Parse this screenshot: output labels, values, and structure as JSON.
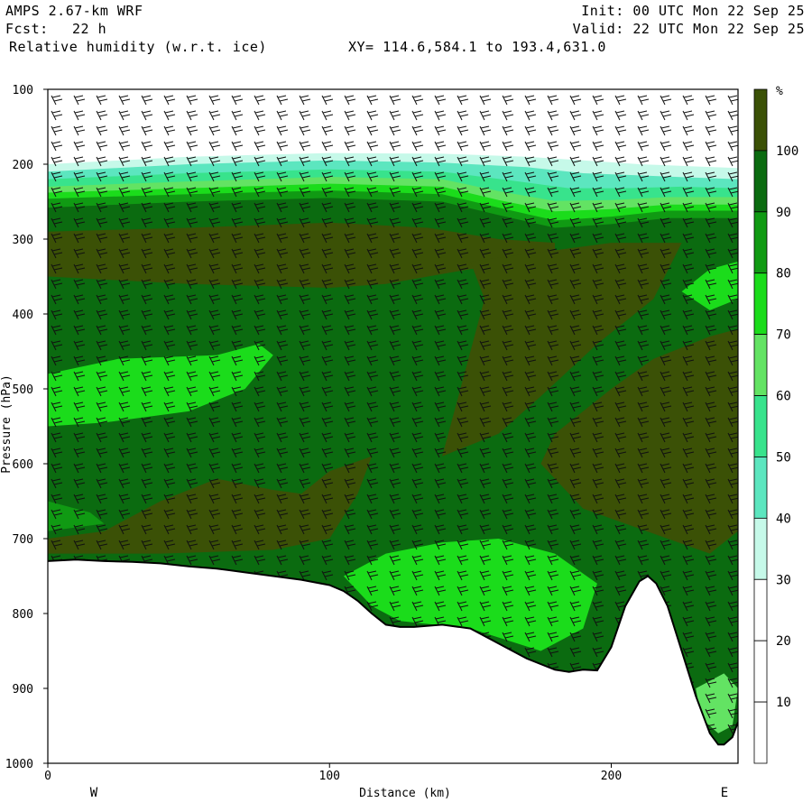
{
  "header": {
    "model": "AMPS 2.67-km WRF",
    "fcst_label": "Fcst:",
    "fcst_value": "22 h",
    "field": "Relative humidity (w.r.t. ice)",
    "xy": "XY= 114.6,584.1 to 193.4,631.0",
    "init": "Init: 00 UTC Mon 22 Sep 25",
    "valid": "Valid: 22 UTC Mon 22 Sep 25"
  },
  "colors": {
    "c100": "#3b5106",
    "c90": "#0b6b10",
    "c80": "#109a13",
    "c70": "#1bdc1b",
    "c60": "#63e363",
    "c50": "#38e38c",
    "c40": "#5ce6bf",
    "c30": "#c6f9e9",
    "c20": "#ffffff",
    "c10": "#ffffff",
    "c0": "#ffffff"
  },
  "chart_data": {
    "type": "heatmap",
    "xlabel": "Distance (km)",
    "ylabel": "Pressure (hPa)",
    "xlim": [
      0,
      245
    ],
    "ylim": [
      1000,
      100
    ],
    "x_ticks": [
      "0",
      "100",
      "200"
    ],
    "x_tick_values": [
      0,
      100,
      200
    ],
    "y_ticks": [
      "100",
      "200",
      "300",
      "400",
      "500",
      "600",
      "700",
      "800",
      "900",
      "1000"
    ],
    "y_tick_values": [
      100,
      200,
      300,
      400,
      500,
      600,
      700,
      800,
      900,
      1000
    ],
    "west_label": "W",
    "east_label": "E",
    "colorbar": {
      "unit": "%",
      "levels": [
        10,
        20,
        30,
        40,
        50,
        60,
        70,
        80,
        90,
        100
      ],
      "labels": [
        "10",
        "20",
        "30",
        "40",
        "50",
        "60",
        "70",
        "80",
        "90",
        "100"
      ]
    },
    "terrain": {
      "x": [
        0,
        10,
        20,
        30,
        40,
        50,
        60,
        70,
        80,
        90,
        100,
        105,
        110,
        115,
        120,
        125,
        130,
        140,
        150,
        160,
        170,
        180,
        185,
        190,
        195,
        200,
        205,
        210,
        213,
        216,
        220,
        225,
        230,
        235,
        238,
        240,
        243,
        245
      ],
      "p": [
        730,
        728,
        730,
        731,
        733,
        737,
        740,
        745,
        750,
        755,
        762,
        770,
        783,
        800,
        815,
        818,
        818,
        815,
        820,
        840,
        860,
        875,
        878,
        875,
        876,
        845,
        790,
        757,
        750,
        760,
        790,
        850,
        910,
        960,
        975,
        975,
        965,
        945
      ]
    },
    "humidity_layers": [
      {
        "level": 30,
        "top": [
          [
            0,
            200
          ],
          [
            50,
            190
          ],
          [
            100,
            185
          ],
          [
            140,
            186
          ],
          [
            170,
            190
          ],
          [
            190,
            195
          ],
          [
            210,
            200
          ],
          [
            230,
            203
          ],
          [
            245,
            205
          ]
        ]
      },
      {
        "level": 40,
        "top": [
          [
            0,
            210
          ],
          [
            50,
            200
          ],
          [
            100,
            195
          ],
          [
            140,
            198
          ],
          [
            170,
            204
          ],
          [
            190,
            212
          ],
          [
            210,
            215
          ],
          [
            230,
            218
          ],
          [
            245,
            220
          ]
        ]
      },
      {
        "level": 50,
        "top": [
          [
            0,
            220
          ],
          [
            50,
            212
          ],
          [
            100,
            207
          ],
          [
            140,
            210
          ],
          [
            165,
            222
          ],
          [
            185,
            232
          ],
          [
            205,
            232
          ],
          [
            225,
            230
          ],
          [
            245,
            232
          ]
        ]
      },
      {
        "level": 60,
        "top": [
          [
            0,
            230
          ],
          [
            50,
            223
          ],
          [
            100,
            217
          ],
          [
            140,
            220
          ],
          [
            160,
            236
          ],
          [
            180,
            249
          ],
          [
            200,
            248
          ],
          [
            220,
            244
          ],
          [
            245,
            244
          ]
        ]
      },
      {
        "level": 70,
        "top": [
          [
            0,
            238
          ],
          [
            50,
            232
          ],
          [
            100,
            226
          ],
          [
            140,
            230
          ],
          [
            160,
            248
          ],
          [
            180,
            263
          ],
          [
            200,
            260
          ],
          [
            220,
            254
          ],
          [
            245,
            254
          ]
        ]
      },
      {
        "level": 80,
        "top": [
          [
            0,
            246
          ],
          [
            50,
            240
          ],
          [
            100,
            235
          ],
          [
            140,
            240
          ],
          [
            160,
            258
          ],
          [
            180,
            275
          ],
          [
            200,
            270
          ],
          [
            220,
            262
          ],
          [
            245,
            262
          ]
        ]
      },
      {
        "level": 90,
        "top": [
          [
            0,
            258
          ],
          [
            50,
            250
          ],
          [
            100,
            245
          ],
          [
            140,
            250
          ],
          [
            160,
            268
          ],
          [
            180,
            285
          ],
          [
            200,
            280
          ],
          [
            220,
            272
          ],
          [
            245,
            272
          ]
        ]
      }
    ],
    "humidity_patches": [
      {
        "level": 100,
        "points": [
          [
            0,
            290
          ],
          [
            50,
            285
          ],
          [
            100,
            278
          ],
          [
            135,
            285
          ],
          [
            160,
            300
          ],
          [
            180,
            305
          ],
          [
            180,
            330
          ],
          [
            150,
            340
          ],
          [
            120,
            360
          ],
          [
            100,
            365
          ],
          [
            50,
            360
          ],
          [
            0,
            350
          ]
        ]
      },
      {
        "level": 100,
        "points": [
          [
            150,
            330
          ],
          [
            200,
            305
          ],
          [
            225,
            305
          ],
          [
            215,
            380
          ],
          [
            195,
            440
          ],
          [
            175,
            510
          ],
          [
            160,
            560
          ],
          [
            140,
            590
          ],
          [
            145,
            520
          ],
          [
            150,
            450
          ],
          [
            155,
            380
          ]
        ]
      },
      {
        "level": 100,
        "points": [
          [
            180,
            560
          ],
          [
            200,
            500
          ],
          [
            215,
            460
          ],
          [
            235,
            430
          ],
          [
            245,
            420
          ],
          [
            245,
            690
          ],
          [
            235,
            720
          ],
          [
            220,
            700
          ],
          [
            205,
            680
          ],
          [
            190,
            660
          ],
          [
            175,
            600
          ]
        ]
      },
      {
        "level": 100,
        "points": [
          [
            0,
            700
          ],
          [
            20,
            690
          ],
          [
            40,
            650
          ],
          [
            60,
            620
          ],
          [
            80,
            635
          ],
          [
            90,
            640
          ],
          [
            100,
            610
          ],
          [
            115,
            590
          ],
          [
            110,
            640
          ],
          [
            100,
            700
          ],
          [
            80,
            715
          ],
          [
            40,
            720
          ],
          [
            0,
            720
          ]
        ]
      },
      {
        "level": 70,
        "points": [
          [
            0,
            480
          ],
          [
            25,
            460
          ],
          [
            60,
            455
          ],
          [
            75,
            440
          ],
          [
            80,
            455
          ],
          [
            70,
            500
          ],
          [
            50,
            530
          ],
          [
            20,
            545
          ],
          [
            0,
            550
          ]
        ]
      },
      {
        "level": 70,
        "points": [
          [
            225,
            370
          ],
          [
            235,
            340
          ],
          [
            245,
            330
          ],
          [
            245,
            380
          ],
          [
            235,
            395
          ]
        ]
      },
      {
        "level": 70,
        "points": [
          [
            105,
            750
          ],
          [
            120,
            720
          ],
          [
            140,
            705
          ],
          [
            160,
            700
          ],
          [
            180,
            720
          ],
          [
            195,
            760
          ],
          [
            190,
            820
          ],
          [
            175,
            850
          ],
          [
            150,
            820
          ],
          [
            125,
            810
          ],
          [
            115,
            790
          ]
        ]
      },
      {
        "level": 80,
        "points": [
          [
            0,
            650
          ],
          [
            15,
            665
          ],
          [
            20,
            680
          ],
          [
            0,
            690
          ]
        ]
      },
      {
        "level": 60,
        "points": [
          [
            230,
            900
          ],
          [
            240,
            880
          ],
          [
            245,
            900
          ],
          [
            243,
            950
          ],
          [
            238,
            960
          ],
          [
            232,
            940
          ]
        ]
      }
    ]
  }
}
